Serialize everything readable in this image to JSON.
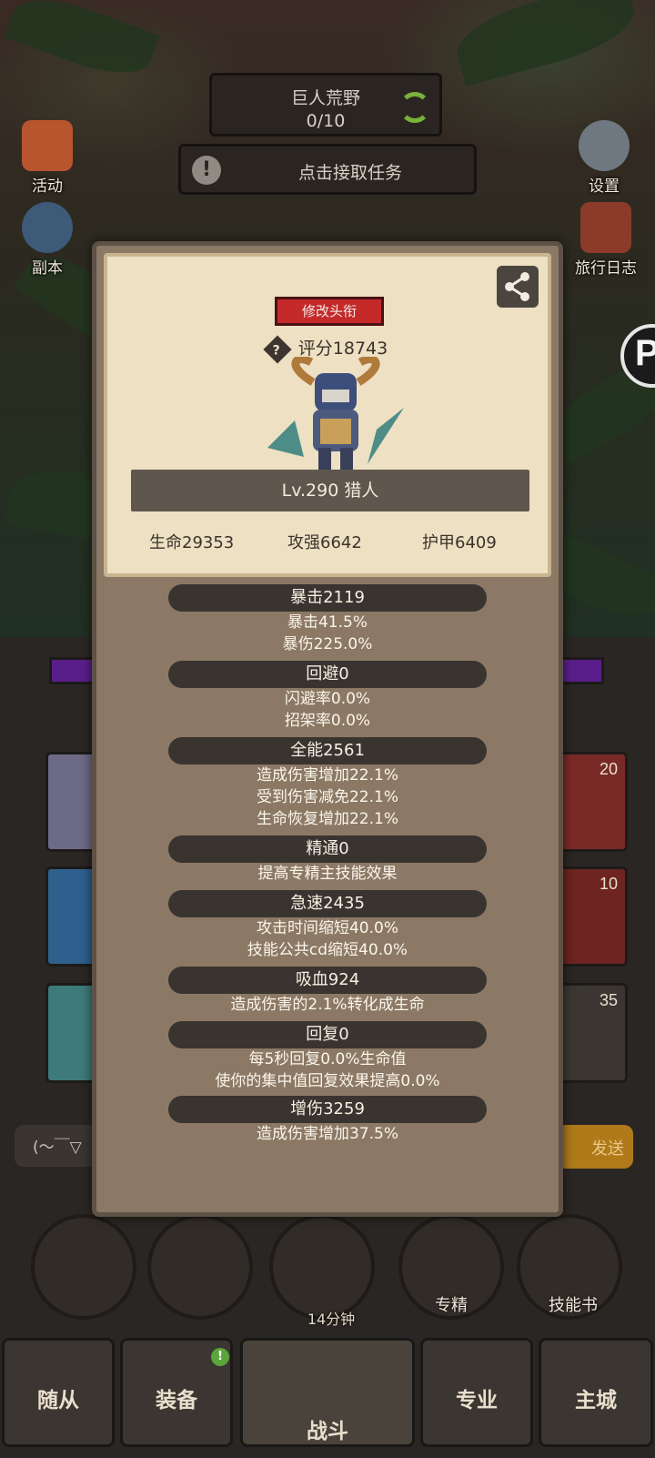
{
  "hud": {
    "zone_name": "巨人荒野",
    "zone_progress": "0/10",
    "quest_badge": "!",
    "quest_text": "点击接取任务",
    "left_buttons": [
      "活动",
      "副本"
    ],
    "right_buttons": [
      "设置",
      "旅行日志"
    ],
    "edge_button_glyph": "P"
  },
  "profile": {
    "title_button": "修改头衔",
    "score_icon": "?",
    "score_label": "评分18743",
    "level_label": "Lv.290 猎人",
    "hp": "生命29353",
    "attack": "攻强6642",
    "armor": "护甲6409"
  },
  "stats": [
    {
      "header": "暴击2119",
      "lines": [
        "暴击41.5%",
        "暴伤225.0%"
      ]
    },
    {
      "header": "回避0",
      "lines": [
        "闪避率0.0%",
        "招架率0.0%"
      ]
    },
    {
      "header": "全能2561",
      "lines": [
        "造成伤害增加22.1%",
        "受到伤害减免22.1%",
        "生命恢复增加22.1%"
      ]
    },
    {
      "header": "精通0",
      "lines": [
        "提高专精主技能效果"
      ]
    },
    {
      "header": "急速2435",
      "lines": [
        "攻击时间缩短40.0%",
        "技能公共cd缩短40.0%"
      ]
    },
    {
      "header": "吸血924",
      "lines": [
        "造成伤害的2.1%转化成生命"
      ]
    },
    {
      "header": "回复0",
      "lines": [
        "每5秒回复0.0%生命值",
        "使你的集中值回复效果提高0.0%"
      ]
    },
    {
      "header": "增伤3259",
      "lines": [
        "造成伤害增加37.5%"
      ]
    }
  ],
  "background": {
    "slot_counts": [
      "20",
      "10",
      "35"
    ],
    "chat_placeholder": "(～￣▽",
    "send_label": "发送",
    "round_labels": [
      "专精",
      "技能书"
    ],
    "chest_timer": "14分钟"
  },
  "bottom_nav": {
    "tabs": [
      "随从",
      "装备",
      "战斗",
      "专业",
      "主城"
    ],
    "equip_badge": "!"
  },
  "colors": {
    "modal": "#8b7965",
    "card": "#ede0c3",
    "title_red": "#c42a2a",
    "stat_header": "#3a3430",
    "accent_green": "#7bb23a"
  }
}
